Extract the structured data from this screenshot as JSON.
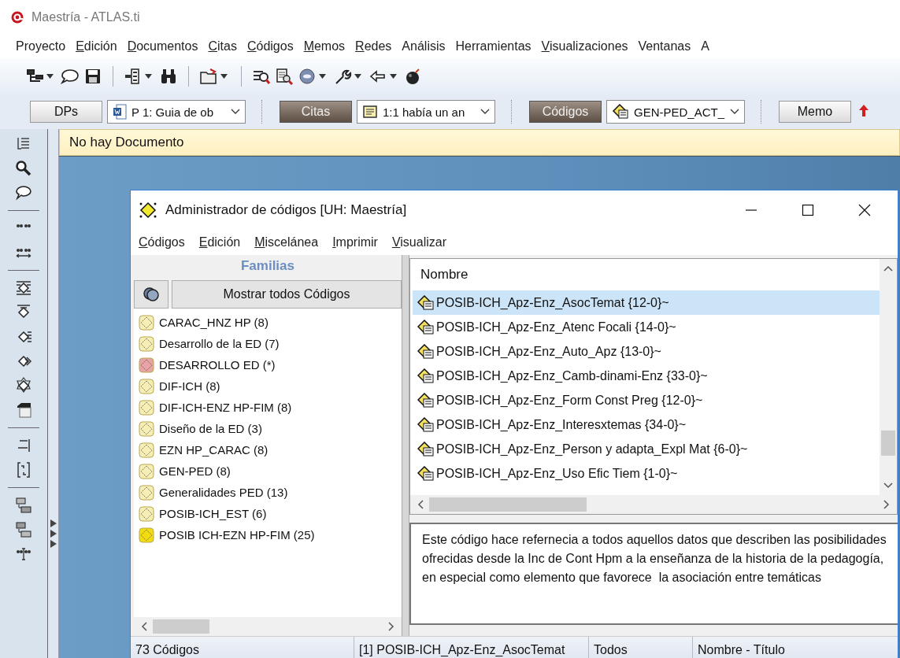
{
  "window": {
    "title": "Maestría - ATLAS.ti"
  },
  "menu": [
    {
      "label": "Proyecto",
      "underlined_first": false
    },
    {
      "label": "Edición",
      "underlined_first": true
    },
    {
      "label": "Documentos",
      "underlined_first": true
    },
    {
      "label": "Citas",
      "underlined_first": true
    },
    {
      "label": "Códigos",
      "underlined_first": true
    },
    {
      "label": "Memos",
      "underlined_first": true
    },
    {
      "label": "Redes",
      "underlined_first": true
    },
    {
      "label": "Análisis",
      "underlined_first": false
    },
    {
      "label": "Herramientas",
      "underlined_first": false
    },
    {
      "label": "Visualizaciones",
      "underlined_first": true
    },
    {
      "label": "Ventanas",
      "underlined_first": false
    },
    {
      "label": "A",
      "underlined_first": false
    }
  ],
  "selector_bar": [
    {
      "kind": "button",
      "label": "DPs",
      "active": false
    },
    {
      "kind": "combo",
      "label": "P 1: Guia de ob"
    },
    {
      "kind": "button",
      "label": "Citas",
      "active": true
    },
    {
      "kind": "combo",
      "label": "1:1 había un an"
    },
    {
      "kind": "button",
      "label": "Códigos",
      "active": true
    },
    {
      "kind": "combo",
      "label": "GEN-PED_ACT_"
    },
    {
      "kind": "button",
      "label": "Memo",
      "active": false
    }
  ],
  "document_bar": {
    "text": "No hay Documento"
  },
  "code_manager": {
    "title": "Administrador de códigos [UH: Maestría]",
    "menu": [
      {
        "label": "Códigos",
        "underlined_first": true
      },
      {
        "label": "Edición",
        "underlined_first": true
      },
      {
        "label": "Miscelánea",
        "underlined_first": true
      },
      {
        "label": "Imprimir",
        "underlined_first": true
      },
      {
        "label": "Visualizar",
        "underlined_first": true
      }
    ],
    "families": {
      "header": "Familias",
      "show_all_button": "Mostrar todos Códigos",
      "items": [
        {
          "label": "CARAC_HNZ HP (8)",
          "color": "#f6eeb4"
        },
        {
          "label": "Desarrollo de la ED (7)",
          "color": "#f6eeb4"
        },
        {
          "label": "DESARROLLO ED (*)",
          "color": "#e8a4a4"
        },
        {
          "label": "DIF-ICH (8)",
          "color": "#f6eeb4"
        },
        {
          "label": "DIF-ICH-ENZ HP-FIM (8)",
          "color": "#f6eeb4"
        },
        {
          "label": "Diseño de la ED (3)",
          "color": "#f6eeb4"
        },
        {
          "label": "EZN HP_CARAC (8)",
          "color": "#f6eeb4"
        },
        {
          "label": "GEN-PED (8)",
          "color": "#f6eeb4"
        },
        {
          "label": "Generalidades PED (13)",
          "color": "#f6eeb4"
        },
        {
          "label": "POSIB-ICH_EST (6)",
          "color": "#f6eeb4"
        },
        {
          "label": "POSIB ICH-EZN HP-FIM (25)",
          "color": "#f2dc10"
        }
      ]
    },
    "codes": {
      "column": "Nombre",
      "rows": [
        {
          "label": "POSIB-ICH_Apz-Enz_AsocTemat {12-0}~",
          "selected": true
        },
        {
          "label": "POSIB-ICH_Apz-Enz_Atenc Focali {14-0}~",
          "selected": false
        },
        {
          "label": "POSIB-ICH_Apz-Enz_Auto_Apz {13-0}~",
          "selected": false
        },
        {
          "label": "POSIB-ICH_Apz-Enz_Camb-dinami-Enz {33-0}~",
          "selected": false
        },
        {
          "label": "POSIB-ICH_Apz-Enz_Form Const Preg {12-0}~",
          "selected": false
        },
        {
          "label": "POSIB-ICH_Apz-Enz_Interesxtemas {34-0}~",
          "selected": false
        },
        {
          "label": "POSIB-ICH_Apz-Enz_Person y adapta_Expl Mat {6-0}~",
          "selected": false
        },
        {
          "label": "POSIB-ICH_Apz-Enz_Uso Efic Tiem {1-0}~",
          "selected": false
        }
      ]
    },
    "comment": "Este código hace refernecia a todos aquellos datos que describen las posibilidades ofrecidas desde la Inc de Cont Hpm a la enseñanza de la historia de la pedagogía, en especial como elemento que favorece  la asociación entre temáticas",
    "status_bar": [
      "73 Códigos",
      "[1] POSIB-ICH_Apz-Enz_AsocTemat",
      "Todos",
      "Nombre - Título"
    ]
  }
}
